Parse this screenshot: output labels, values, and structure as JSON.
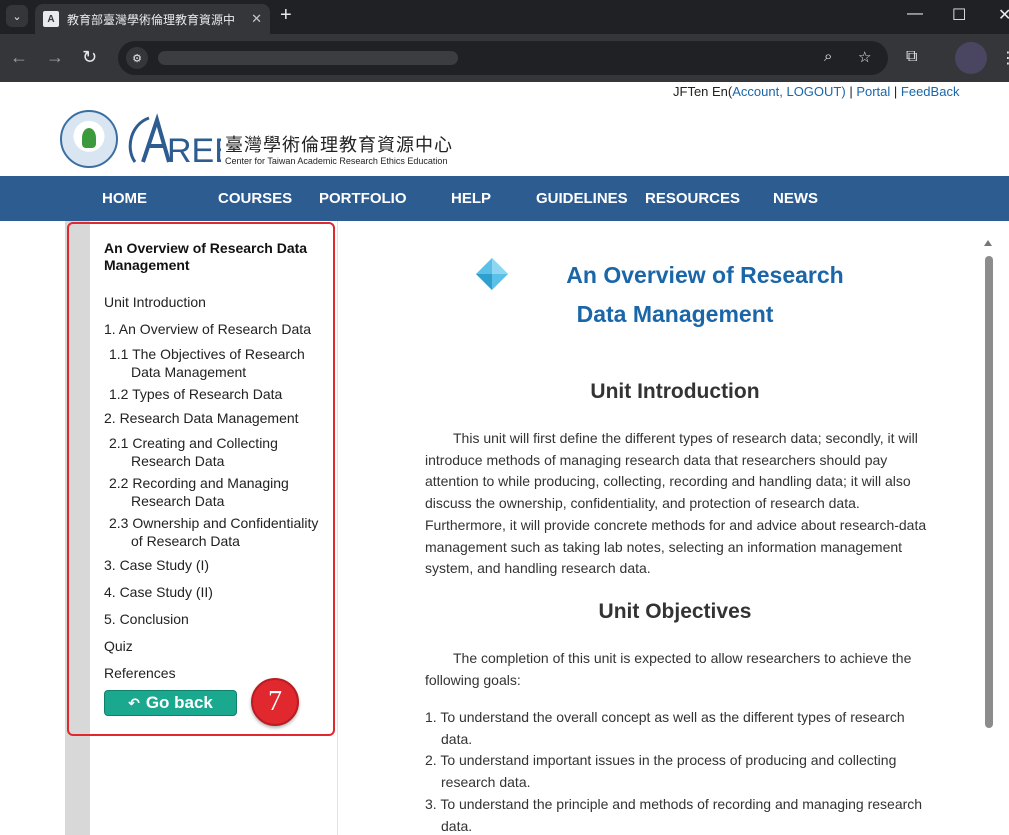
{
  "browser": {
    "tab_title": "教育部臺灣學術倫理教育資源中",
    "tab_close": "✕",
    "new_tab": "+",
    "minimize": "—",
    "maximize": "☐",
    "close": "✕"
  },
  "userbar": {
    "name": "JFTen En(",
    "account": "Account",
    "sep1": ", ",
    "logout": "LOGOUT",
    "close_paren": ")",
    "sep2": " | ",
    "portal": "Portal",
    "sep3": " | ",
    "feedback": "FeedBack"
  },
  "logo": {
    "zh": "臺灣學術倫理教育資源中心",
    "en": "Center for Taiwan Academic Research Ethics Education"
  },
  "nav": [
    "HOME",
    "COURSES",
    "PORTFOLIO",
    "HELP",
    "GUIDELINES",
    "RESOURCES",
    "NEWS"
  ],
  "sidebar": {
    "title": "An Overview of Research Data Management",
    "items": [
      "Unit Introduction",
      "1. An Overview of Research Data",
      "1.1 The Objectives of Research Data Management",
      "1.2 Types of Research Data",
      "2. Research Data Management",
      "2.1 Creating and Collecting Research Data",
      "2.2 Recording and Managing Research Data",
      "2.3 Ownership and Confidentiality of Research Data",
      "3. Case Study (I)",
      "4. Case Study (II)",
      "5. Conclusion",
      "Quiz",
      "References"
    ],
    "go_back": "Go back",
    "badge": "7"
  },
  "content": {
    "title": "An Overview of Research Data Management",
    "intro_heading": "Unit Introduction",
    "intro_text": "This unit will first define the different types of research data; secondly, it will introduce methods of managing research data that researchers should pay attention to while producing, collecting, recording and handling data; it will also discuss the ownership, confidentiality, and protection of research data. Furthermore, it will provide concrete methods for and advice about research-data management such as taking lab notes, selecting an information management system, and handling research data.",
    "objectives_heading": "Unit Objectives",
    "objectives_text": "The completion of this unit is expected to allow researchers to achieve the following goals:",
    "objectives": [
      "1. To understand the overall concept as well as the different types of research data.",
      "2. To understand important issues in the process of producing and collecting research data.",
      "3. To understand the principle and methods of recording and managing research data."
    ]
  },
  "colors": {
    "nav_bg": "#2d5c91",
    "title_blue": "#1a66a8",
    "go_back": "#1aa88f",
    "highlight": "#e0282e"
  }
}
